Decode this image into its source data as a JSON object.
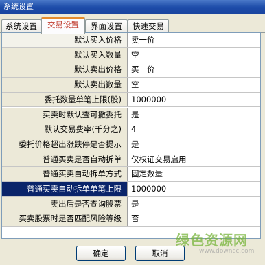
{
  "window": {
    "title": "系统设置"
  },
  "tabs": [
    "系统设置",
    "交易设置",
    "界面设置",
    "快速交易"
  ],
  "rows": [
    {
      "label": "默认买入价格",
      "value": "卖一价"
    },
    {
      "label": "默认买入数量",
      "value": "空"
    },
    {
      "label": "默认卖出价格",
      "value": "买一价"
    },
    {
      "label": "默认卖出数量",
      "value": "空"
    },
    {
      "label": "委托数量单笔上限(股)",
      "value": "1000000"
    },
    {
      "label": "买卖时默认查可撤委托",
      "value": "是"
    },
    {
      "label": "默认交易费率(千分之)",
      "value": "4"
    },
    {
      "label": "委托价格超出涨跌停是否提示",
      "value": "是"
    },
    {
      "label": "普通买卖是否自动拆单",
      "value": "仅权证交易启用"
    },
    {
      "label": "普通买卖自动拆单方式",
      "value": "固定数量"
    },
    {
      "label": "普通买卖自动拆单单笔上限",
      "value": "1000000"
    },
    {
      "label": "卖出后是否查询股票",
      "value": "是"
    },
    {
      "label": "买卖股票时是否匹配风险等级",
      "value": "否"
    }
  ],
  "buttons": {
    "ok": "确定",
    "cancel": "取消"
  },
  "watermark": {
    "main": "绿色资源网",
    "sub": "www.downcc.com"
  },
  "colors": {
    "selected_row": "#0a246a",
    "title_bar": "#1c4ba8",
    "active_tab_border": "#e68b2c"
  }
}
